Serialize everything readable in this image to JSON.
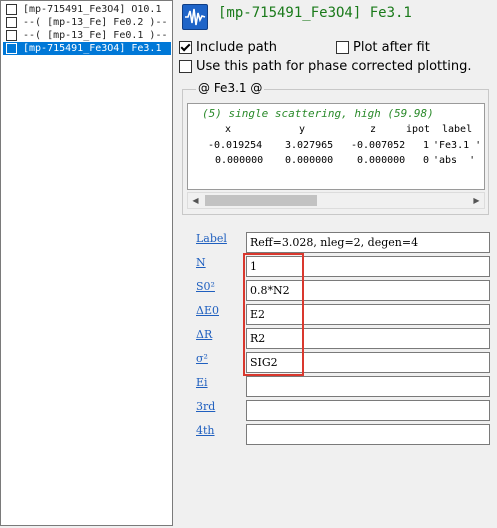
{
  "path_list": [
    {
      "label": "[mp-715491_Fe3O4] O10.1",
      "checked": false,
      "selected": false
    },
    {
      "label": "--( [mp-13_Fe] Fe0.2  )--",
      "checked": false,
      "selected": false
    },
    {
      "label": "--( [mp-13_Fe] Fe0.1  )--",
      "checked": false,
      "selected": false
    },
    {
      "label": "[mp-715491_Fe3O4] Fe3.1",
      "checked": false,
      "selected": true
    }
  ],
  "header": {
    "icon": "waveform-icon",
    "title": "[mp-715491_Fe3O4] Fe3.1"
  },
  "options": {
    "include_path": {
      "label": "Include path",
      "checked": true
    },
    "plot_after_fit": {
      "label": "Plot after fit",
      "checked": false
    },
    "phase_corrected": {
      "label": "Use this path for phase corrected plotting.",
      "checked": false
    }
  },
  "feff_group": {
    "label": "@ Fe3.1  @",
    "comment": "(5) single scattering, high (59.98)",
    "columns": [
      "x",
      "y",
      "z",
      "ipot",
      "label"
    ],
    "rows": [
      [
        "-0.019254",
        "3.027965",
        "-0.007052",
        "1",
        "'Fe3.1 '"
      ],
      [
        "0.000000",
        "0.000000",
        "0.000000",
        "0",
        "'abs  '"
      ]
    ]
  },
  "params": [
    {
      "label": "Label",
      "value": "Reff=3.028, nleg=2, degen=4"
    },
    {
      "label": "N",
      "value": "1"
    },
    {
      "label": "S0²",
      "value": "0.8*N2"
    },
    {
      "label": "ΔE0",
      "value": "E2"
    },
    {
      "label": "ΔR",
      "value": "R2"
    },
    {
      "label": "σ²",
      "value": "SIG2"
    },
    {
      "label": "Ei",
      "value": ""
    },
    {
      "label": "3rd",
      "value": ""
    },
    {
      "label": "4th",
      "value": ""
    }
  ],
  "colors": {
    "title_green": "#1a7a1a",
    "link_blue": "#1f5fbf",
    "selection_blue": "#0078d7",
    "highlight_red": "#d9382e"
  }
}
